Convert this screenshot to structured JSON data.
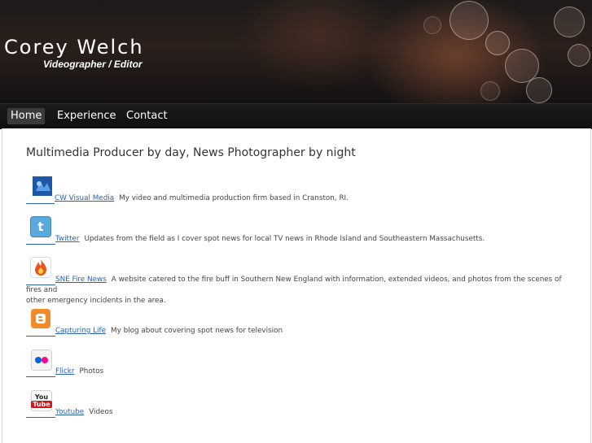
{
  "header": {
    "title": "Corey Welch",
    "subtitle": "Videographer / Editor"
  },
  "nav": {
    "items": [
      {
        "label": "Home",
        "active": true
      },
      {
        "label": "Experience",
        "active": false
      },
      {
        "label": "Contact",
        "active": false
      }
    ]
  },
  "main": {
    "headline": "Multimedia Producer by day, News Photographer by night",
    "links": [
      {
        "icon": "cw-visual-media-icon",
        "label": "CW Visual Media",
        "desc": "My video and multimedia production firm based in Cranston, RI."
      },
      {
        "icon": "twitter-icon",
        "label": "Twitter",
        "desc": "Updates from the field as I cover spot news for local TV news in Rhode Island and Southeastern Massachusetts."
      },
      {
        "icon": "fire-icon",
        "label": "SNE Fire News",
        "desc": "A website catered to the fire buff in Southern New England with information, extended videos, and photos from the scenes of fires and",
        "desc2": "other emergency incidents in the area."
      },
      {
        "icon": "blogger-icon",
        "label": "Capturing Life",
        "desc": "My blog about covering spot news for television"
      },
      {
        "icon": "flickr-icon",
        "label": "Flickr",
        "desc": "Photos"
      },
      {
        "icon": "youtube-icon",
        "label": "Youtube",
        "desc": "Videos",
        "icon_text_top": "You",
        "icon_text_bottom": "Tube"
      }
    ]
  },
  "colors": {
    "link": "#2a62b7",
    "nav_bg": "#141414",
    "active_nav": "#3a3a3a"
  }
}
